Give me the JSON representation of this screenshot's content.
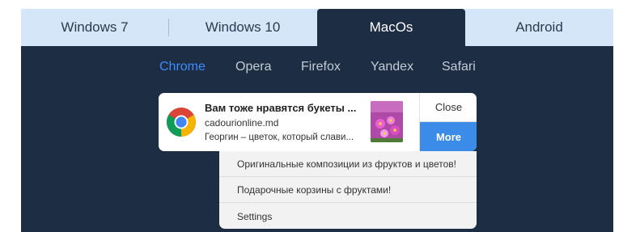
{
  "tabs": [
    {
      "label": "Windows 7"
    },
    {
      "label": "Windows 10"
    },
    {
      "label": "MacOs"
    },
    {
      "label": "Android"
    }
  ],
  "active_tab": "MacOs",
  "browsers": [
    {
      "label": "Chrome"
    },
    {
      "label": "Opera"
    },
    {
      "label": "Firefox"
    },
    {
      "label": "Yandex"
    },
    {
      "label": "Safari"
    }
  ],
  "active_browser": "Chrome",
  "notification": {
    "icon": "chrome-icon",
    "title": "Вам тоже нравятся букеты ...",
    "site": "cadourionline.md",
    "message": "Георгин – цветок, который слави...",
    "close_label": "Close",
    "more_label": "More"
  },
  "menu": {
    "items": [
      {
        "label": "Оригинальные композиции из фруктов и цветов!"
      },
      {
        "label": "Подарочные корзины с фруктами!"
      },
      {
        "label": "Settings"
      }
    ]
  },
  "colors": {
    "panel_bg": "#1d2d44",
    "tab_bar_bg": "#d5e6f8",
    "active_browser": "#3d8bff",
    "more_button": "#3b8ce8"
  }
}
